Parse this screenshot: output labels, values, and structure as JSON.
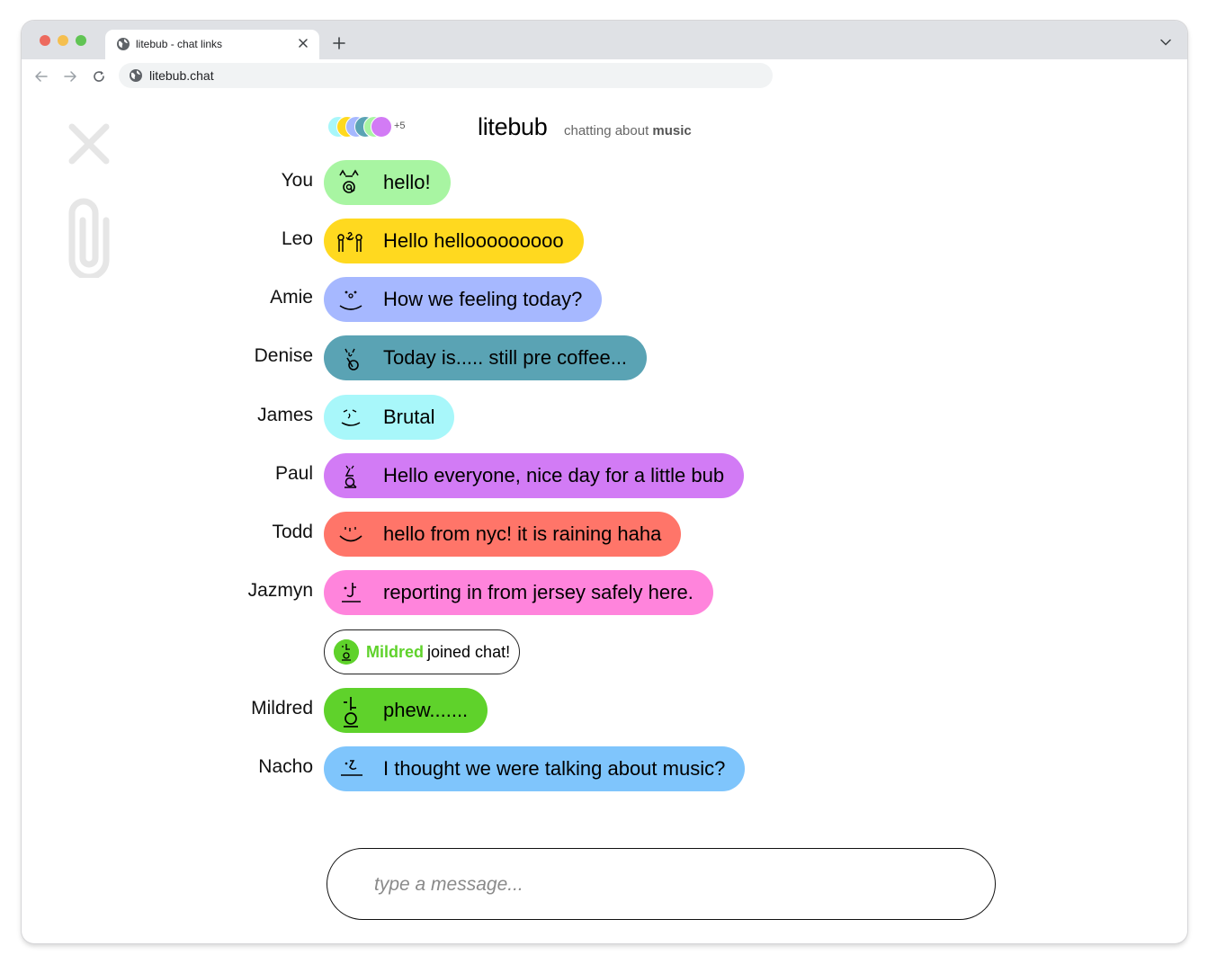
{
  "browser": {
    "tab_title": "litebub - chat links",
    "url": "litebub.chat"
  },
  "header": {
    "brand": "litebub",
    "tagline_prefix": "chatting about",
    "tagline_topic": "music",
    "participants_extra": "+5"
  },
  "colors": {
    "you": "#a8f5a2",
    "leo": "#ffd91f",
    "amie": "#a6b8ff",
    "denise": "#5aa3b4",
    "james": "#a8f7fa",
    "paul": "#d27bf5",
    "todd": "#ff7569",
    "jazmyn": "#ff84dc",
    "mildred": "#5fd22b",
    "nacho": "#7fc5fc"
  },
  "messages": [
    {
      "name": "You",
      "text": "hello!"
    },
    {
      "name": "Leo",
      "text": "Hello hellooooooooo"
    },
    {
      "name": "Amie",
      "text": "How we feeling today?"
    },
    {
      "name": "Denise",
      "text": "Today is..... still pre coffee..."
    },
    {
      "name": "James",
      "text": "Brutal"
    },
    {
      "name": "Paul",
      "text": "Hello everyone, nice day for a little bub"
    },
    {
      "name": "Todd",
      "text": "hello from nyc! it is raining haha"
    },
    {
      "name": "Jazmyn",
      "text": "reporting in from jersey safely here."
    },
    {
      "name": "Mildred",
      "text": "phew......."
    },
    {
      "name": "Nacho",
      "text": "I thought we were talking about music?"
    }
  ],
  "join_event": {
    "name": "Mildred",
    "text": "joined chat!"
  },
  "composer": {
    "placeholder": "type a message..."
  },
  "icons": {
    "close": "close-icon",
    "attach": "paperclip-icon",
    "globe": "globe-icon"
  }
}
